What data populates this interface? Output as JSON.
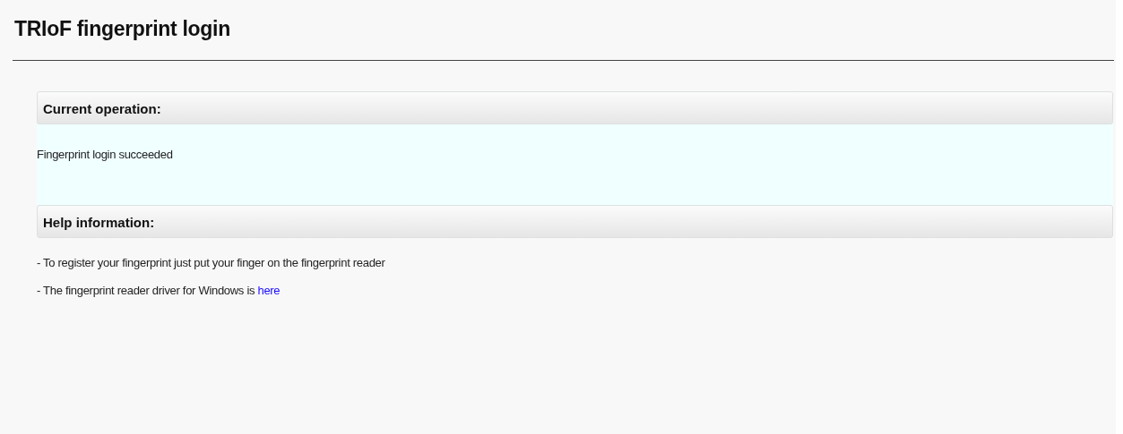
{
  "page": {
    "title": "TRIoF fingerprint login"
  },
  "current_operation": {
    "title": "Current operation:",
    "message": "Fingerprint login succeeded"
  },
  "help": {
    "title": "Help information:",
    "lines": [
      {
        "text": "- To register your fingerprint just put your finger on the fingerprint reader"
      },
      {
        "text": "- The fingerprint reader driver for Windows is ",
        "link": "here"
      }
    ]
  }
}
